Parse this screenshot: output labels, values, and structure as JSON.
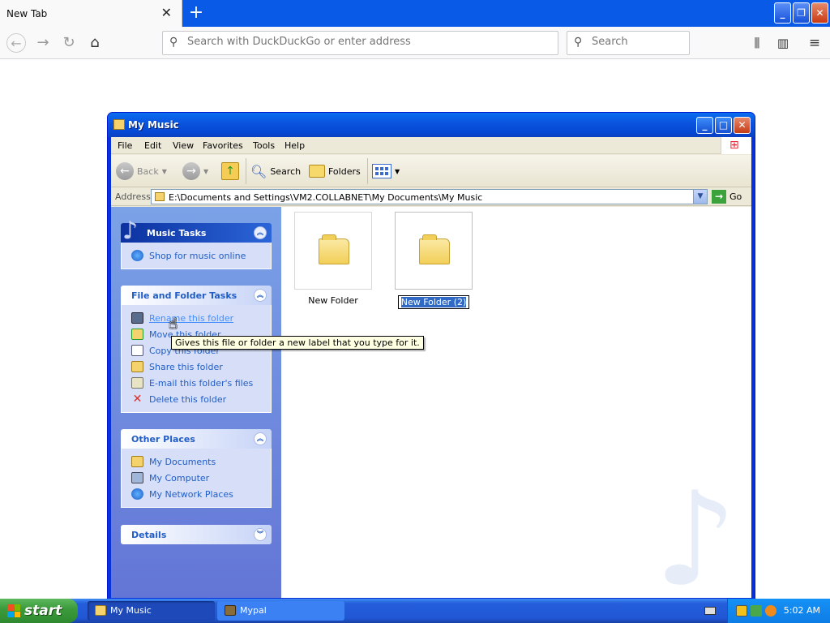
{
  "browser": {
    "tab_title": "New Tab",
    "tab_close": "✕",
    "new_tab": "+",
    "url_placeholder": "Search with DuckDuckGo or enter address",
    "search_placeholder": "Search"
  },
  "window": {
    "title": "My Music",
    "menu": [
      "File",
      "Edit",
      "View",
      "Favorites",
      "Tools",
      "Help"
    ],
    "toolbar": {
      "back": "Back",
      "search": "Search",
      "folders": "Folders"
    },
    "address": {
      "label": "Address",
      "value": "E:\\Documents and Settings\\VM2.COLLABNET\\My Documents\\My Music",
      "go": "Go"
    }
  },
  "taskpane": {
    "music_tasks": {
      "title": "Music Tasks",
      "items": [
        "Shop for music online"
      ]
    },
    "file_folder_tasks": {
      "title": "File and Folder Tasks",
      "items": [
        "Rename this folder",
        "Move this folder",
        "Copy this folder",
        "Share this folder",
        "E-mail this folder's files",
        "Delete this folder"
      ]
    },
    "other_places": {
      "title": "Other Places",
      "items": [
        "My Documents",
        "My Computer",
        "My Network Places"
      ]
    },
    "details": {
      "title": "Details"
    }
  },
  "files": [
    {
      "name": "New Folder"
    },
    {
      "name": "New Folder (2)"
    }
  ],
  "tooltip": "Gives this file or folder a new label that you type for it.",
  "taskbar": {
    "start": "start",
    "tasks": [
      "My Music",
      "Mypal"
    ],
    "clock": "5:02 AM"
  },
  "colors": {
    "xp_blue": "#0a52dd",
    "taskpane_link": "#215dc6",
    "start_green": "#3c9b3c",
    "selection": "#316ac5"
  }
}
